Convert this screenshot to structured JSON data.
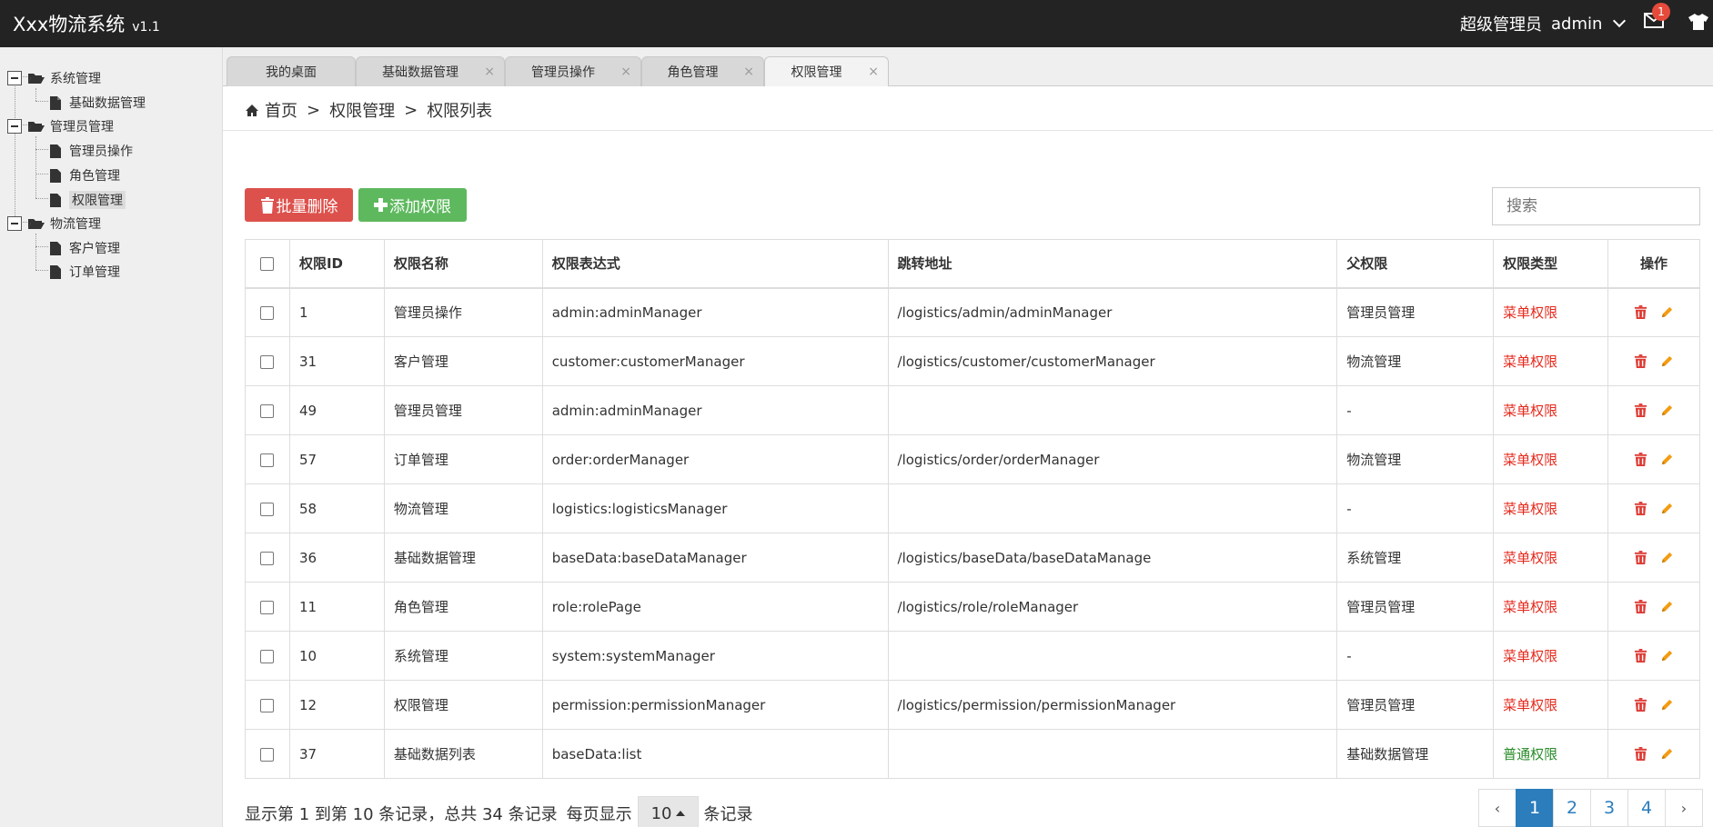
{
  "app": {
    "title": "Xxx物流系统",
    "version": "v1.1"
  },
  "header": {
    "role": "超级管理员",
    "user": "admin",
    "badge_count": "1"
  },
  "sidebar": {
    "groups": [
      {
        "label": "系统管理",
        "items": [
          {
            "label": "基础数据管理"
          }
        ]
      },
      {
        "label": "管理员管理",
        "items": [
          {
            "label": "管理员操作"
          },
          {
            "label": "角色管理"
          },
          {
            "label": "权限管理"
          }
        ]
      },
      {
        "label": "物流管理",
        "items": [
          {
            "label": "客户管理"
          },
          {
            "label": "订单管理"
          }
        ]
      }
    ],
    "active_item": "权限管理"
  },
  "tabs": [
    {
      "label": "我的桌面"
    },
    {
      "label": "基础数据管理"
    },
    {
      "label": "管理员操作"
    },
    {
      "label": "角色管理"
    },
    {
      "label": "权限管理"
    }
  ],
  "tab_close_glyph": "×",
  "breadcrumb": {
    "home": "首页",
    "sep": ">",
    "level1": "权限管理",
    "level2": "权限列表"
  },
  "toolbar": {
    "batch_delete": "批量删除",
    "add": "添加权限",
    "search_placeholder": "搜索"
  },
  "table": {
    "headers": {
      "id": "权限ID",
      "name": "权限名称",
      "expr": "权限表达式",
      "url": "跳转地址",
      "parent": "父权限",
      "type": "权限类型",
      "ops": "操作"
    },
    "rows": [
      {
        "id": "1",
        "name": "管理员操作",
        "expr": "admin:adminManager",
        "url": "/logistics/admin/adminManager",
        "parent": "管理员管理",
        "type": "菜单权限"
      },
      {
        "id": "31",
        "name": "客户管理",
        "expr": "customer:customerManager",
        "url": "/logistics/customer/customerManager",
        "parent": "物流管理",
        "type": "菜单权限"
      },
      {
        "id": "49",
        "name": "管理员管理",
        "expr": "admin:adminManager",
        "url": "",
        "parent": "-",
        "type": "菜单权限"
      },
      {
        "id": "57",
        "name": "订单管理",
        "expr": "order:orderManager",
        "url": "/logistics/order/orderManager",
        "parent": "物流管理",
        "type": "菜单权限"
      },
      {
        "id": "58",
        "name": "物流管理",
        "expr": "logistics:logisticsManager",
        "url": "",
        "parent": "-",
        "type": "菜单权限"
      },
      {
        "id": "36",
        "name": "基础数据管理",
        "expr": "baseData:baseDataManager",
        "url": "/logistics/baseData/baseDataManage",
        "parent": "系统管理",
        "type": "菜单权限"
      },
      {
        "id": "11",
        "name": "角色管理",
        "expr": "role:rolePage",
        "url": "/logistics/role/roleManager",
        "parent": "管理员管理",
        "type": "菜单权限"
      },
      {
        "id": "10",
        "name": "系统管理",
        "expr": "system:systemManager",
        "url": "",
        "parent": "-",
        "type": "菜单权限"
      },
      {
        "id": "12",
        "name": "权限管理",
        "expr": "permission:permissionManager",
        "url": "/logistics/permission/permissionManager",
        "parent": "管理员管理",
        "type": "菜单权限"
      },
      {
        "id": "37",
        "name": "基础数据列表",
        "expr": "baseData:list",
        "url": "",
        "parent": "基础数据管理",
        "type": "普通权限"
      }
    ]
  },
  "footer": {
    "info": "显示第 1 到第 10 条记录，总共 34 条记录",
    "per_page_prefix": "每页显示",
    "per_page_value": "10",
    "per_page_suffix": "条记录"
  },
  "pagination": {
    "prev": "‹",
    "pages": [
      "1",
      "2",
      "3",
      "4"
    ],
    "next": "›",
    "current": "1"
  },
  "colors": {
    "header_bg": "#232323",
    "danger": "#dd514c",
    "success": "#5eb95e",
    "primary": "#2b7dbc",
    "menu_type": "#e5291c",
    "normal_type": "#2a8c2a"
  }
}
